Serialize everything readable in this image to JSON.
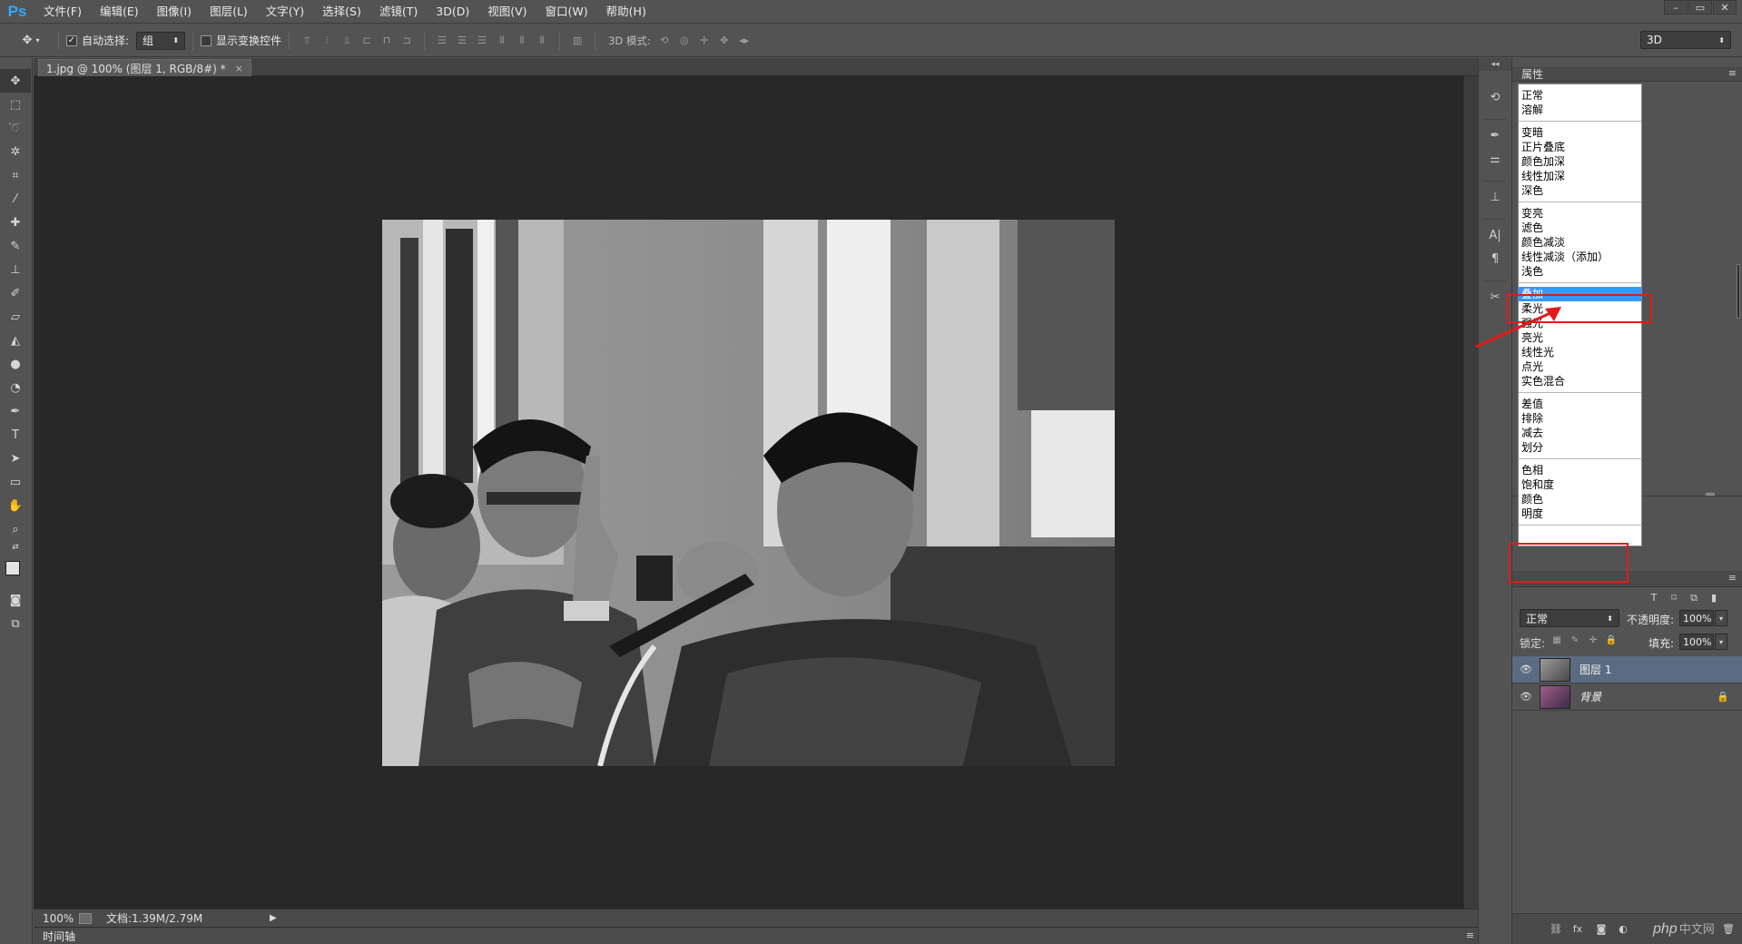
{
  "app": {
    "logo": "Ps",
    "menus": [
      "文件(F)",
      "编辑(E)",
      "图像(I)",
      "图层(L)",
      "文字(Y)",
      "选择(S)",
      "滤镜(T)",
      "3D(D)",
      "视图(V)",
      "窗口(W)",
      "帮助(H)"
    ],
    "window_controls": [
      "–",
      "▭",
      "✕"
    ]
  },
  "options_bar": {
    "auto_select_label": "自动选择:",
    "auto_select_checked": true,
    "auto_select_value": "组",
    "show_transform_label": "显示变换控件",
    "show_transform_checked": false,
    "mode_3d_label": "3D 模式:",
    "workspace": "3D"
  },
  "document": {
    "tab_title": "1.jpg @ 100% (图层 1, RGB/8#) *",
    "close_symbol": "×"
  },
  "status": {
    "zoom": "100%",
    "doc_size": "文档:1.39M/2.79M",
    "arrow": "▶"
  },
  "timeline": {
    "label": "时间轴"
  },
  "properties": {
    "title": "属性",
    "menu_symbol": "≡"
  },
  "blend_modes": {
    "groups": [
      [
        "正常",
        "溶解"
      ],
      [
        "变暗",
        "正片叠底",
        "颜色加深",
        "线性加深",
        "深色"
      ],
      [
        "变亮",
        "滤色",
        "颜色减淡",
        "线性减淡（添加）",
        "浅色"
      ],
      [
        "叠加",
        "柔光",
        "强光",
        "亮光",
        "线性光",
        "点光",
        "实色混合"
      ],
      [
        "差值",
        "排除",
        "减去",
        "划分"
      ],
      [
        "色相",
        "饱和度",
        "颜色",
        "明度"
      ]
    ],
    "highlighted": "叠加"
  },
  "layers": {
    "blend_value": "正常",
    "opacity_label": "不透明度:",
    "opacity_value": "100%",
    "lock_label": "锁定:",
    "fill_label": "填充:",
    "fill_value": "100%",
    "items": [
      {
        "name": "图层 1",
        "selected": true
      },
      {
        "name": "背景",
        "selected": false
      }
    ]
  },
  "watermark": {
    "text": "php",
    "suffix": "中文网"
  },
  "colors": {
    "accent_logo": "#31a8ff",
    "highlight": "#3399ff",
    "annotation_red": "#e21a1a",
    "panel_bg": "#535353",
    "canvas_bg": "#282828"
  }
}
